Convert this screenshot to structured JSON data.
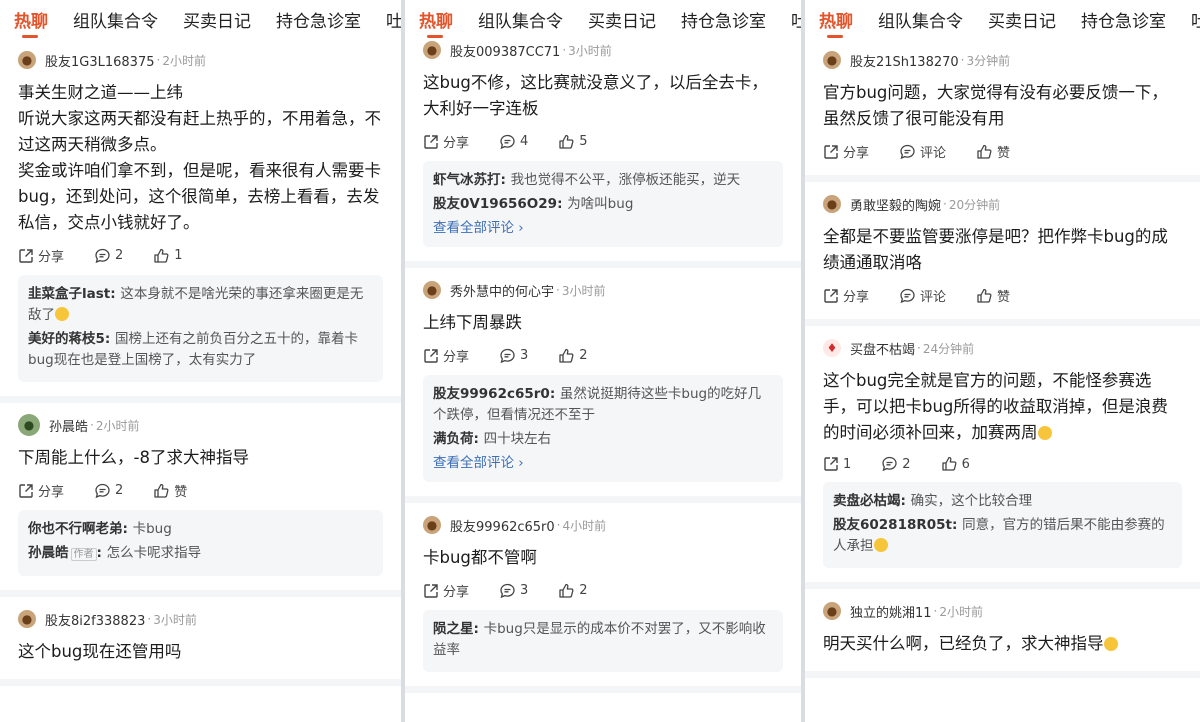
{
  "panels": [
    {
      "tabs": [
        "热聊",
        "组队集合令",
        "买卖日记",
        "持仓急诊室",
        "吐槽"
      ],
      "posts": [
        {
          "author": "股友1G3L168375",
          "time": "2小时前",
          "avatar": "cow",
          "content": "事关生财之道——上纬\n听说大家这两天都没有赶上热乎的，不用着急，不过这两天稍微多点。\n奖金或许咱们拿不到，但是呢，看来很有人需要卡bug，还到处问，这个很简单，去榜上看看，去发私信，交点小钱就好了。",
          "share": "分享",
          "comment_count": "2",
          "like": "1",
          "comments": [
            {
              "name": "韭菜盒子last",
              "text": "这本身就不是啥光荣的事还拿来圈更是无敌了",
              "emoji": true
            },
            {
              "name": "美好的蒋枝5",
              "text": "国榜上还有之前负百分之五十的，靠着卡bug现在也是登上国榜了，太有实力了"
            }
          ]
        },
        {
          "author": "孙晨皓",
          "time": "2小时前",
          "avatar": "green",
          "content": "下周能上什么，-8了求大神指导",
          "share": "分享",
          "comment_count": "2",
          "like": "赞",
          "comments": [
            {
              "name": "你也不行啊老弟",
              "text": "卡bug"
            },
            {
              "name": "孙晨皓",
              "tag": "作者",
              "text": "怎么卡呢求指导"
            }
          ]
        },
        {
          "author": "股友8i2f338823",
          "time": "3小时前",
          "avatar": "cow",
          "content": "这个bug现在还管用吗"
        }
      ]
    },
    {
      "tabs": [
        "热聊",
        "组队集合令",
        "买卖日记",
        "持仓急诊室",
        "吐槽"
      ],
      "posts": [
        {
          "author": "股友009387CC71",
          "time": "3小时前",
          "avatar": "cow",
          "content": "这bug不修，这比赛就没意义了，以后全去卡，大利好一字连板",
          "share": "分享",
          "comment_count": "4",
          "like": "5",
          "comments": [
            {
              "name": "虾气冰苏打",
              "text": "我也觉得不公平，涨停板还能买，逆天"
            },
            {
              "name": "股友0V19656O29",
              "text": "为啥叫bug"
            }
          ],
          "view_all": "查看全部评论 ›"
        },
        {
          "author": "秀外慧中的何心宇",
          "time": "3小时前",
          "avatar": "cow",
          "content": "上纬下周暴跌",
          "share": "分享",
          "comment_count": "3",
          "like": "2",
          "comments": [
            {
              "name": "股友99962c65r0",
              "text": "虽然说挺期待这些卡bug的吃好几个跌停，但看情况还不至于"
            },
            {
              "name": "满负荷",
              "text": "四十块左右"
            }
          ],
          "view_all": "查看全部评论 ›"
        },
        {
          "author": "股友99962c65r0",
          "time": "4小时前",
          "avatar": "cow",
          "content": "卡bug都不管啊",
          "share": "分享",
          "comment_count": "3",
          "like": "2",
          "comments": [
            {
              "name": "陨之星",
              "text": "卡bug只是显示的成本价不对罢了，又不影响收益率"
            }
          ]
        }
      ]
    },
    {
      "tabs": [
        "热聊",
        "组队集合令",
        "买卖日记",
        "持仓急诊室",
        "吐槽"
      ],
      "posts": [
        {
          "author": "股友21Sh138270",
          "time": "3分钟前",
          "avatar": "cow",
          "content": "官方bug问题，大家觉得有没有必要反馈一下，虽然反馈了很可能没有用",
          "share": "分享",
          "comment_count": "评论",
          "like": "赞"
        },
        {
          "author": "勇敢坚毅的陶婉",
          "time": "20分钟前",
          "avatar": "cow",
          "content": "全都是不要监管要涨停是吧？把作弊卡bug的成绩通通取消咯",
          "share": "分享",
          "comment_count": "评论",
          "like": "赞"
        },
        {
          "author": "买盘不枯竭",
          "time": "24分钟前",
          "avatar": "red",
          "content": "这个bug完全就是官方的问题，不能怪参赛选手，可以把卡bug所得的收益取消掉，但是浪费的时间必须补回来，加赛两周",
          "content_emoji": true,
          "share": "1",
          "comment_count": "2",
          "like": "6",
          "comments": [
            {
              "name": "卖盘必枯竭",
              "text": "确实，这个比较合理"
            },
            {
              "name": "股友602818R05t",
              "text": "同意，官方的错后果不能由参赛的人承担",
              "emoji": true
            }
          ]
        },
        {
          "author": "独立的姚湘11",
          "time": "2小时前",
          "avatar": "cow",
          "content": "明天买什么啊，已经负了，求大神指导",
          "content_emoji": true
        }
      ]
    }
  ],
  "colors": {
    "accent": "#e4542b",
    "link": "#3d6fb6",
    "comment_bg": "#f5f6f8"
  },
  "icons": {
    "share": "share-icon",
    "comment": "comment-icon",
    "like": "thumbs-up-icon",
    "avatar": "cow-avatar-icon"
  }
}
